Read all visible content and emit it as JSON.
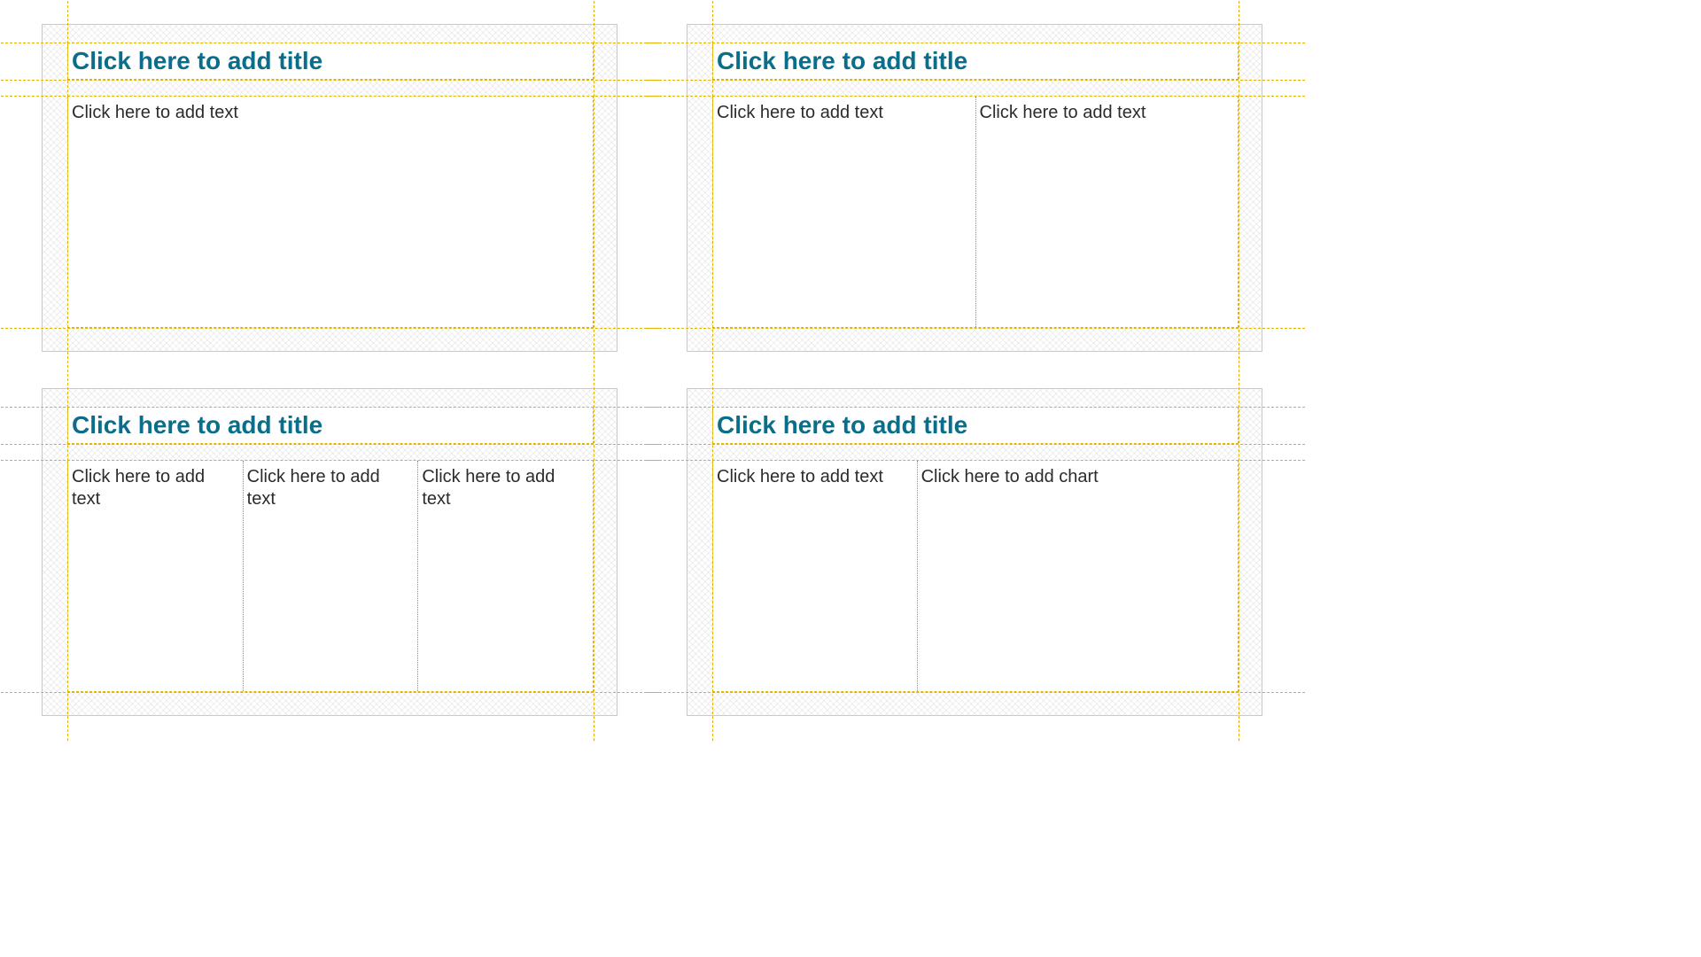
{
  "slides": [
    {
      "title": "Click here to add title",
      "columns": [
        "Click here to add text"
      ]
    },
    {
      "title": "Click here to add title",
      "columns": [
        "Click here to add text",
        "Click here to add text"
      ]
    },
    {
      "title": "Click here to add title",
      "columns": [
        "Click here to add text",
        "Click here to add text",
        "Click here to add text"
      ]
    },
    {
      "title": "Click here to add title",
      "columns": [
        "Click here to add text",
        "Click here to add chart"
      ]
    }
  ]
}
